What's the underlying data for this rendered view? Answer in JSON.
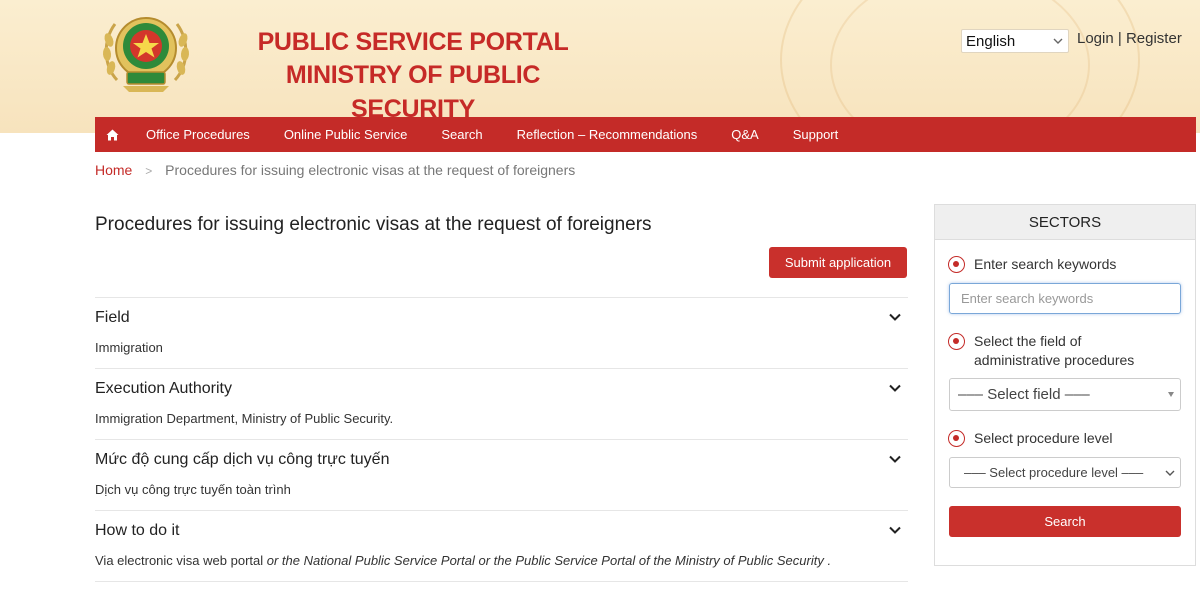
{
  "header": {
    "title_line1": "PUBLIC SERVICE PORTAL",
    "title_line2": "MINISTRY OF PUBLIC SECURITY",
    "language": "English",
    "login": "Login",
    "separator": "|",
    "register": "Register",
    "colors": {
      "brand_red": "#c42b28",
      "header_bg": "#f7e3bd"
    }
  },
  "nav": {
    "home_icon": "home-icon",
    "items": [
      "Office Procedures",
      "Online Public Service",
      "Search",
      "Reflection – Recommendations",
      "Q&A",
      "Support"
    ]
  },
  "breadcrumb": {
    "home": "Home",
    "separator": ">",
    "current": "Procedures for issuing electronic visas at the request of foreigners"
  },
  "main": {
    "title": "Procedures for issuing electronic visas at the request of foreigners",
    "submit_label": "Submit application",
    "sections": [
      {
        "heading": "Field",
        "body": "Immigration"
      },
      {
        "heading": "Execution Authority",
        "body": "Immigration Department, Ministry of Public Security."
      },
      {
        "heading": "Mức độ cung cấp dịch vụ công trực tuyến",
        "body": "Dịch vụ công trực tuyến toàn trình"
      },
      {
        "heading": "How to do it",
        "body_plain": "Via electronic visa web portal ",
        "body_or1": "or",
        "body_mid": " the National Public Service Portal ",
        "body_or2": "or",
        "body_end": " the Public Service Portal of the Ministry of Public Security ."
      }
    ]
  },
  "sidebar": {
    "title": "SECTORS",
    "keyword_label": "Enter search keywords",
    "keyword_placeholder": "Enter search keywords",
    "field_label": "Select the field of administrative procedures",
    "field_select": "––– Select field –––",
    "level_label": "Select procedure level",
    "level_select": "––– Select procedure level –––",
    "search_label": "Search"
  }
}
